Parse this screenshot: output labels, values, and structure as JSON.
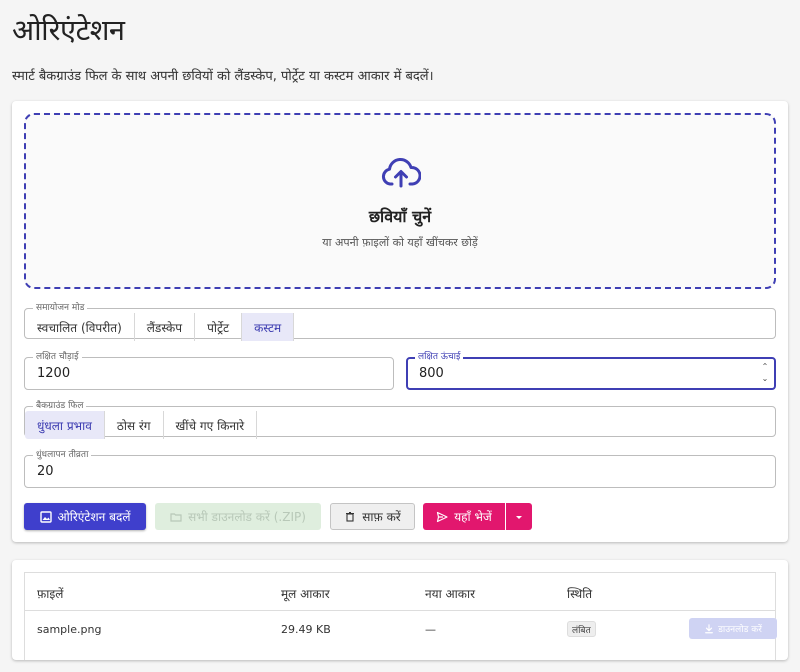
{
  "header": {
    "title": "ओरिएंटेशन",
    "subtitle": "स्मार्ट बैकग्राउंड फिल के साथ अपनी छवियों को लैंडस्केप, पोर्ट्रेट या कस्टम आकार में बदलें।"
  },
  "dropzone": {
    "title": "छवियाँ चुनें",
    "hint": "या अपनी फ़ाइलों को यहाँ खींचकर छोड़ें",
    "icon": "cloud-upload-icon"
  },
  "mode": {
    "label": "समायोजन मोड",
    "options": [
      "स्वचालित (विपरीत)",
      "लैंडस्केप",
      "पोर्ट्रेट",
      "कस्टम"
    ],
    "selected": "कस्टम"
  },
  "target_width": {
    "label": "लक्षित चौड़ाई",
    "value": "1200"
  },
  "target_height": {
    "label": "लक्षित ऊंचाई",
    "value": "800"
  },
  "background": {
    "label": "बैकग्राउंड फिल",
    "options": [
      "धुंधला प्रभाव",
      "ठोस रंग",
      "खींचे गए किनारे"
    ],
    "selected": "धुंधला प्रभाव"
  },
  "blur": {
    "label": "धुंधलापन तीव्रता",
    "value": "20"
  },
  "actions": {
    "orient_label": "ओरिएंटेशन बदलें",
    "zip_label": "सभी डाउनलोड करें (.ZIP)",
    "clear_label": "साफ़ करें",
    "send_label": "यहाँ भेजें"
  },
  "colors": {
    "primary": "#3f3fcc",
    "accent": "#e2176e",
    "dropzone_border": "#3f3fb4"
  },
  "files_table": {
    "headers": [
      "फ़ाइलें",
      "मूल आकार",
      "नया आकार",
      "स्थिति"
    ],
    "rows": [
      {
        "name": "sample.png",
        "original_size": "29.49 KB",
        "new_size": "—",
        "status": "लंबित",
        "download_label": "डाउनलोड करें"
      }
    ]
  }
}
